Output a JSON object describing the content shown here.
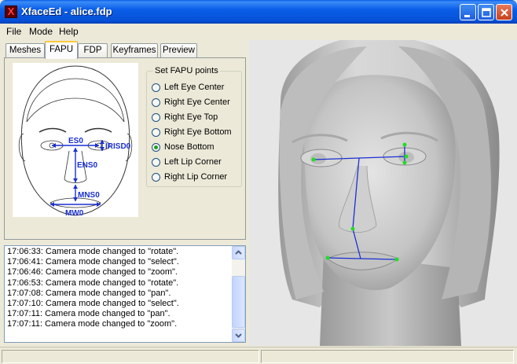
{
  "window": {
    "title": "XfaceEd - alice.fdp"
  },
  "menu": {
    "file": "File",
    "mode": "Mode",
    "help": "Help"
  },
  "tabs": [
    {
      "label": "Meshes"
    },
    {
      "label": "FAPU"
    },
    {
      "label": "FDP"
    },
    {
      "label": "Keyframes"
    },
    {
      "label": "Preview"
    }
  ],
  "active_tab": "FAPU",
  "diagram_labels": {
    "es0": "ES0",
    "irisd0": "IRISD0",
    "ens0": "ENS0",
    "mns0": "MNS0",
    "mw0": "MW0"
  },
  "fapu_group": {
    "title": "Set FAPU points",
    "options": [
      {
        "label": "Left Eye Center",
        "checked": false
      },
      {
        "label": "Right Eye Center",
        "checked": false
      },
      {
        "label": "Right Eye Top",
        "checked": false
      },
      {
        "label": "Right Eye Bottom",
        "checked": false
      },
      {
        "label": "Nose Bottom",
        "checked": true
      },
      {
        "label": "Left Lip Corner",
        "checked": false
      },
      {
        "label": "Right Lip Corner",
        "checked": false
      }
    ]
  },
  "log": [
    "17:06:33: Camera mode changed to \"rotate\".",
    "17:06:41: Camera mode changed to \"select\".",
    "17:06:46: Camera mode changed to \"zoom\".",
    "17:06:53: Camera mode changed to \"rotate\".",
    "17:07:08: Camera mode changed to \"pan\".",
    "17:07:10: Camera mode changed to \"select\".",
    "17:07:11: Camera mode changed to \"pan\".",
    "17:07:11: Camera mode changed to \"zoom\"."
  ],
  "colors": {
    "fapu_blue": "#1a2fd1",
    "point_green": "#22dd22",
    "titlebar": "#0a5ee8"
  }
}
